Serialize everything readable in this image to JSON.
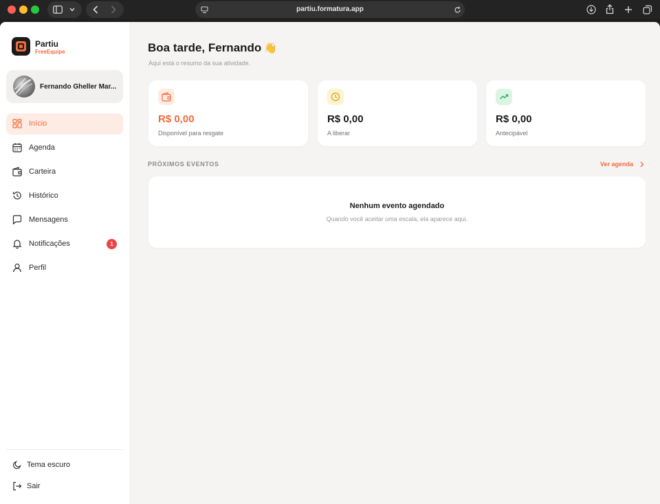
{
  "browser": {
    "url": "partiu.formatura.app"
  },
  "brand": {
    "name": "Partiu",
    "subtitle": "FreeEquipe",
    "accent_color": "#f26b3a"
  },
  "profile": {
    "name": "Fernando Gheller Mar..."
  },
  "nav": {
    "items": [
      {
        "label": "Início",
        "icon": "grid-icon",
        "active": true
      },
      {
        "label": "Agenda",
        "icon": "calendar-icon"
      },
      {
        "label": "Carteira",
        "icon": "wallet-icon"
      },
      {
        "label": "Histórico",
        "icon": "history-icon"
      },
      {
        "label": "Mensagens",
        "icon": "message-icon"
      },
      {
        "label": "Notificações",
        "icon": "bell-icon",
        "badge": "1"
      },
      {
        "label": "Perfil",
        "icon": "user-icon"
      }
    ],
    "footer": [
      {
        "label": "Tema escuro",
        "icon": "moon-icon"
      },
      {
        "label": "Sair",
        "icon": "logout-icon"
      }
    ]
  },
  "main": {
    "greeting": "Boa tarde, Fernando",
    "greeting_emoji": "👋",
    "subtitle": "Aqui está o resumo da sua atividade.",
    "cards": [
      {
        "value": "R$ 0,00",
        "label": "Disponível para resgate",
        "icon": "wallet-icon",
        "color": "#f26b3a"
      },
      {
        "value": "R$ 0,00",
        "label": "A liberar",
        "icon": "clock-icon",
        "color": "#d4a21a"
      },
      {
        "value": "R$ 0,00",
        "label": "Antecipável",
        "icon": "trending-up-icon",
        "color": "#22a55a"
      }
    ],
    "events": {
      "section_title": "PRÓXIMOS EVENTOS",
      "link_label": "Ver agenda",
      "empty_title": "Nenhum evento agendado",
      "empty_subtitle": "Quando você aceitar uma escala, ela aparece aqui."
    }
  }
}
